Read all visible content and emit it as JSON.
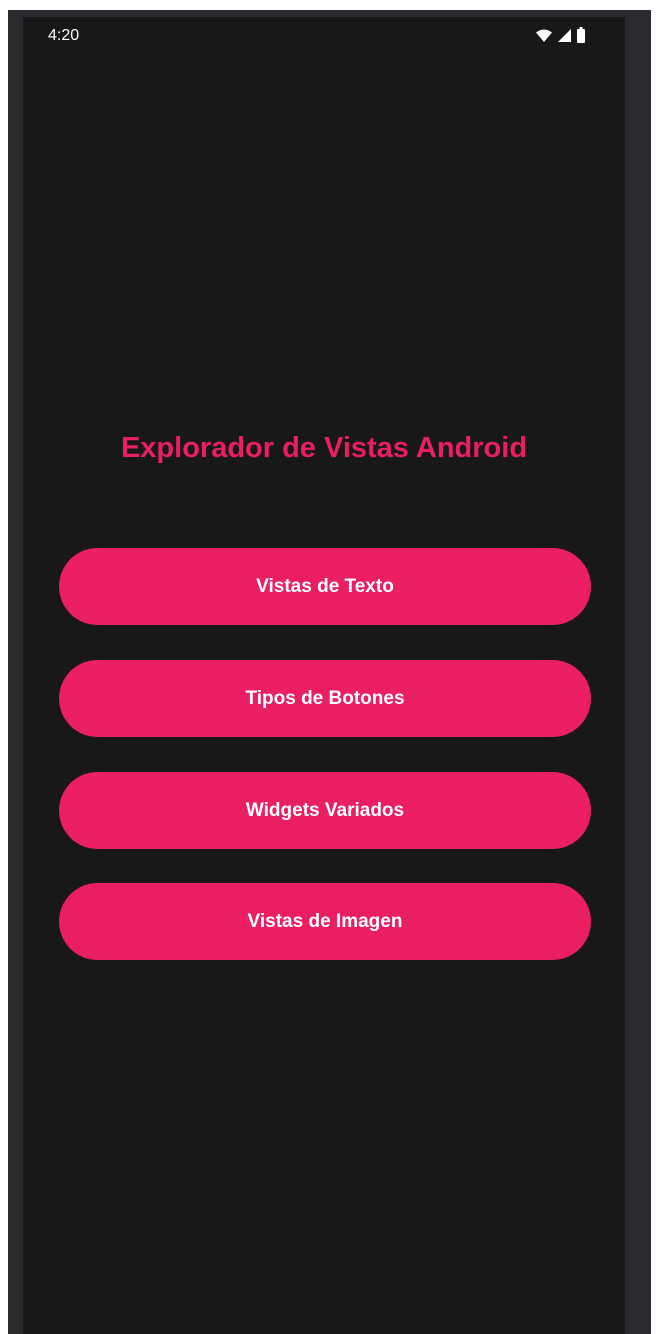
{
  "status_bar": {
    "time": "4:20",
    "icons": [
      "wifi-icon",
      "signal-icon",
      "battery-icon"
    ]
  },
  "main": {
    "title": "Explorador de Vistas Android",
    "buttons": [
      {
        "label": "Vistas de Texto"
      },
      {
        "label": "Tipos de Botones"
      },
      {
        "label": "Widgets Variados"
      },
      {
        "label": "Vistas de Imagen"
      }
    ]
  },
  "colors": {
    "accent": "#e91e63",
    "background": "#181818",
    "frame": "#2a2b2f"
  }
}
